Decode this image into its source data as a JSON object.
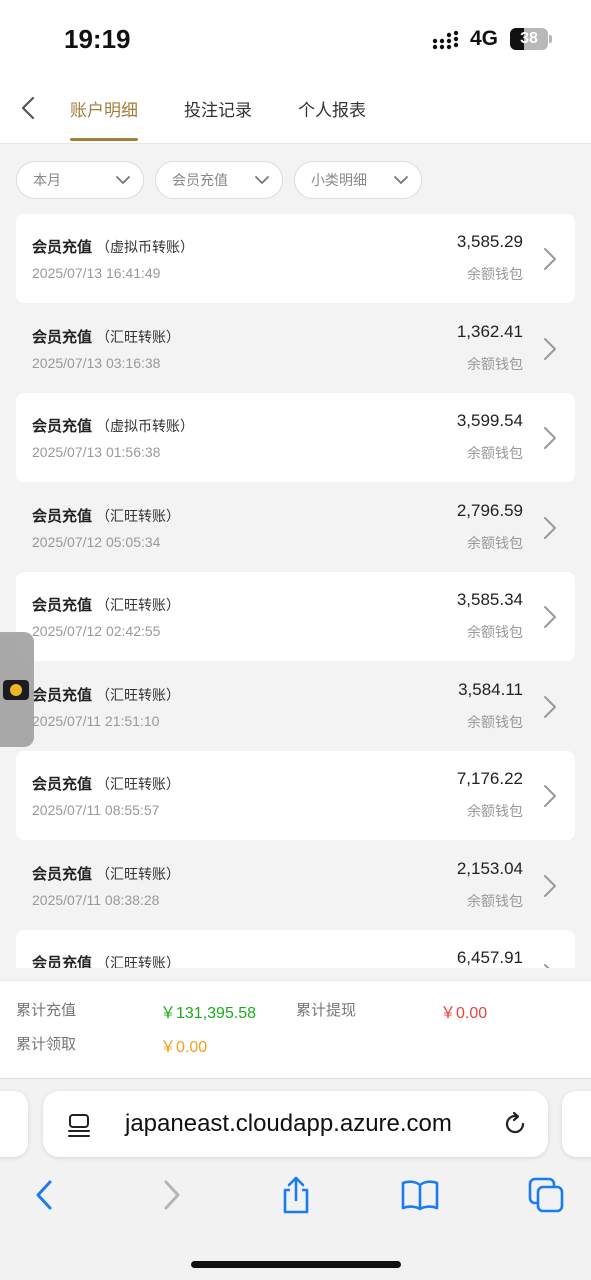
{
  "status_bar": {
    "time": "19:19",
    "network": "4G",
    "battery_level": "38"
  },
  "header": {
    "tabs": [
      {
        "label": "账户明细",
        "active": true
      },
      {
        "label": "投注记录",
        "active": false
      },
      {
        "label": "个人报表",
        "active": false
      }
    ]
  },
  "filters": [
    {
      "label": "本月"
    },
    {
      "label": "会员充值"
    },
    {
      "label": "小类明细"
    }
  ],
  "records": [
    {
      "title": "会员充值",
      "sub": "（虚拟币转账）",
      "date": "2025/07/13 16:41:49",
      "amount": "3,585.29",
      "wallet": "余额钱包"
    },
    {
      "title": "会员充值",
      "sub": "（汇旺转账）",
      "date": "2025/07/13 03:16:38",
      "amount": "1,362.41",
      "wallet": "余额钱包"
    },
    {
      "title": "会员充值",
      "sub": "（虚拟币转账）",
      "date": "2025/07/13 01:56:38",
      "amount": "3,599.54",
      "wallet": "余额钱包"
    },
    {
      "title": "会员充值",
      "sub": "（汇旺转账）",
      "date": "2025/07/12 05:05:34",
      "amount": "2,796.59",
      "wallet": "余额钱包"
    },
    {
      "title": "会员充值",
      "sub": "（汇旺转账）",
      "date": "2025/07/12 02:42:55",
      "amount": "3,585.34",
      "wallet": "余额钱包"
    },
    {
      "title": "会员充值",
      "sub": "（汇旺转账）",
      "date": "2025/07/11 21:51:10",
      "amount": "3,584.11",
      "wallet": "余额钱包"
    },
    {
      "title": "会员充值",
      "sub": "（汇旺转账）",
      "date": "2025/07/11 08:55:57",
      "amount": "7,176.22",
      "wallet": "余额钱包"
    },
    {
      "title": "会员充值",
      "sub": "（汇旺转账）",
      "date": "2025/07/11 08:38:28",
      "amount": "2,153.04",
      "wallet": "余额钱包"
    },
    {
      "title": "会员充值",
      "sub": "（汇旺转账）",
      "date": "",
      "amount": "6,457.91",
      "wallet": ""
    }
  ],
  "summary": {
    "total_recharge_label": "累计充值",
    "total_recharge_value": "￥131,395.58",
    "total_withdraw_label": "累计提现",
    "total_withdraw_value": "￥0.00",
    "total_claim_label": "累计领取",
    "total_claim_value": "￥0.00"
  },
  "browser": {
    "url": "japaneast.cloudapp.azure.com"
  },
  "colors": {
    "accent": "#a67c3d",
    "recharge_green": "#1aad19",
    "withdraw_red": "#e64340",
    "claim_orange": "#f0a020",
    "ios_blue": "#1a7cf2"
  }
}
